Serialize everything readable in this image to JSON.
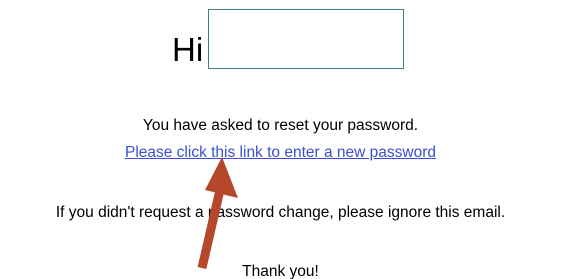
{
  "email": {
    "greeting": "Hi",
    "name_value": "",
    "reset_text": "You have asked to reset your password.",
    "reset_link_label": "Please click this link to enter a new password",
    "ignore_text": "If you didn't request a password change, please ignore this email.",
    "thanks_text": "Thank you!"
  },
  "colors": {
    "link": "#3b4fd0",
    "name_box_border": "#3f7f7f",
    "arrow": "#b5472a"
  },
  "icons": {
    "annotation": "arrow-up-icon"
  }
}
